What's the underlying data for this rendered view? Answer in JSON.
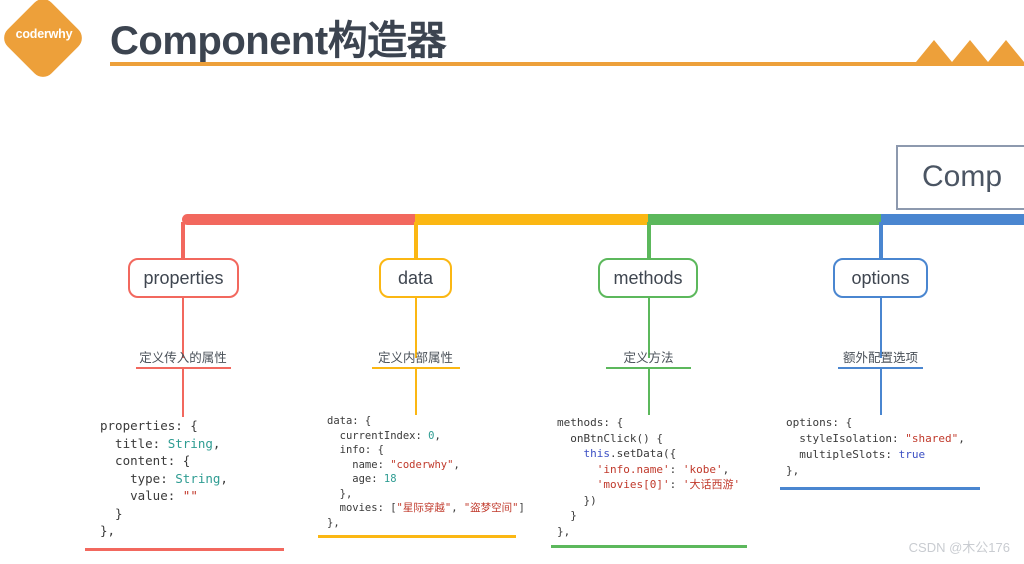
{
  "header": {
    "logo_text": "coderwhy",
    "title": "Component构造器",
    "logo_color": "#eda03a",
    "rule_color": "#eda03a",
    "title_color": "#3c4450"
  },
  "root": {
    "label": "Comp",
    "border_color": "#8d99ae"
  },
  "branches": [
    {
      "id": "properties",
      "label": "properties",
      "caption": "定义传入的属性",
      "color": "#f2685e",
      "code_lines": [
        [
          {
            "t": "properties: {",
            "c": "plain"
          }
        ],
        [
          {
            "t": "  title: ",
            "c": "plain"
          },
          {
            "t": "String",
            "c": "t"
          },
          {
            "t": ",",
            "c": "plain"
          }
        ],
        [
          {
            "t": "  content: {",
            "c": "plain"
          }
        ],
        [
          {
            "t": "    type: ",
            "c": "plain"
          },
          {
            "t": "String",
            "c": "t"
          },
          {
            "t": ",",
            "c": "plain"
          }
        ],
        [
          {
            "t": "    value: ",
            "c": "plain"
          },
          {
            "t": "\"\"",
            "c": "s"
          }
        ],
        [
          {
            "t": "  }",
            "c": "plain"
          }
        ],
        [
          {
            "t": "},",
            "c": "plain"
          }
        ]
      ]
    },
    {
      "id": "data",
      "label": "data",
      "caption": "定义内部属性",
      "color": "#fbb713",
      "code_lines": [
        [
          {
            "t": "data: {",
            "c": "plain"
          }
        ],
        [
          {
            "t": "  currentIndex: ",
            "c": "plain"
          },
          {
            "t": "0",
            "c": "n"
          },
          {
            "t": ",",
            "c": "plain"
          }
        ],
        [
          {
            "t": "  info: {",
            "c": "plain"
          }
        ],
        [
          {
            "t": "    name: ",
            "c": "plain"
          },
          {
            "t": "\"coderwhy\"",
            "c": "s"
          },
          {
            "t": ",",
            "c": "plain"
          }
        ],
        [
          {
            "t": "    age: ",
            "c": "plain"
          },
          {
            "t": "18",
            "c": "n"
          }
        ],
        [
          {
            "t": "  },",
            "c": "plain"
          }
        ],
        [
          {
            "t": "  movies: [",
            "c": "plain"
          },
          {
            "t": "\"星际穿越\"",
            "c": "s"
          },
          {
            "t": ", ",
            "c": "plain"
          },
          {
            "t": "\"盗梦空间\"",
            "c": "s"
          },
          {
            "t": "]",
            "c": "plain"
          }
        ],
        [
          {
            "t": "},",
            "c": "plain"
          }
        ]
      ]
    },
    {
      "id": "methods",
      "label": "methods",
      "caption": "定义方法",
      "color": "#5cb85c",
      "code_lines": [
        [
          {
            "t": "methods: {",
            "c": "plain"
          }
        ],
        [
          {
            "t": "  onBtnClick() {",
            "c": "plain"
          }
        ],
        [
          {
            "t": "    ",
            "c": "plain"
          },
          {
            "t": "this",
            "c": "k"
          },
          {
            "t": ".setData({",
            "c": "plain"
          }
        ],
        [
          {
            "t": "      ",
            "c": "plain"
          },
          {
            "t": "'info.name'",
            "c": "s"
          },
          {
            "t": ": ",
            "c": "plain"
          },
          {
            "t": "'kobe'",
            "c": "s"
          },
          {
            "t": ",",
            "c": "plain"
          }
        ],
        [
          {
            "t": "      ",
            "c": "plain"
          },
          {
            "t": "'movies[0]'",
            "c": "s"
          },
          {
            "t": ": ",
            "c": "plain"
          },
          {
            "t": "'大话西游'",
            "c": "s"
          }
        ],
        [
          {
            "t": "    })",
            "c": "plain"
          }
        ],
        [
          {
            "t": "  }",
            "c": "plain"
          }
        ],
        [
          {
            "t": "},",
            "c": "plain"
          }
        ]
      ]
    },
    {
      "id": "options",
      "label": "options",
      "caption": "额外配置选项",
      "color": "#4a86d0",
      "code_lines": [
        [
          {
            "t": "options: {",
            "c": "plain"
          }
        ],
        [
          {
            "t": "  styleIsolation: ",
            "c": "plain"
          },
          {
            "t": "\"shared\"",
            "c": "s"
          },
          {
            "t": ",",
            "c": "plain"
          }
        ],
        [
          {
            "t": "  multipleSlots: ",
            "c": "plain"
          },
          {
            "t": "true",
            "c": "k"
          }
        ],
        [
          {
            "t": "},",
            "c": "plain"
          }
        ]
      ]
    }
  ],
  "watermark": "CSDN @木公176"
}
